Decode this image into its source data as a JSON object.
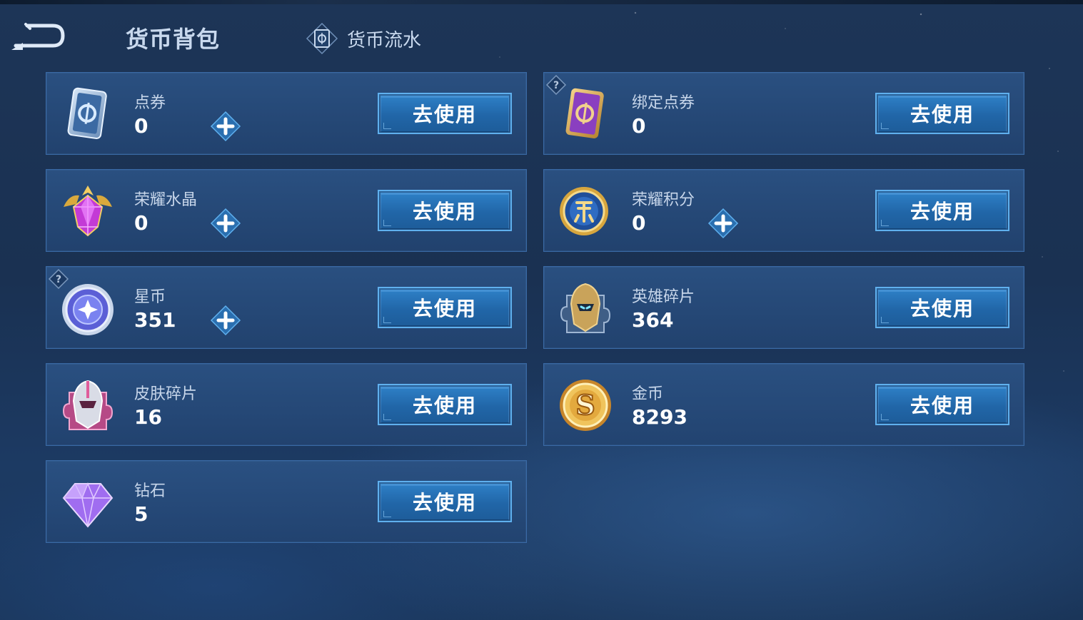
{
  "header": {
    "title": "货币背包",
    "flow_label": "货币流水"
  },
  "colors": {
    "accent": "#5fb0ee",
    "card_bg": "#2b5284",
    "button_bg": "#2166a8"
  },
  "currencies": [
    {
      "name": "点券",
      "value": "0",
      "icon": "voucher-card-icon",
      "has_add": true,
      "has_help": false,
      "button": "去使用"
    },
    {
      "name": "绑定点券",
      "value": "0",
      "icon": "bound-voucher-card-icon",
      "has_add": false,
      "has_help": true,
      "button": "去使用"
    },
    {
      "name": "荣耀水晶",
      "value": "0",
      "icon": "glory-crystal-icon",
      "has_add": true,
      "has_help": false,
      "button": "去使用"
    },
    {
      "name": "荣耀积分",
      "value": "0",
      "icon": "glory-points-icon",
      "has_add": true,
      "has_help": false,
      "button": "去使用"
    },
    {
      "name": "星币",
      "value": "351",
      "icon": "star-coin-icon",
      "has_add": true,
      "has_help": true,
      "button": "去使用"
    },
    {
      "name": "英雄碎片",
      "value": "364",
      "icon": "hero-fragment-icon",
      "has_add": false,
      "has_help": false,
      "button": "去使用"
    },
    {
      "name": "皮肤碎片",
      "value": "16",
      "icon": "skin-fragment-icon",
      "has_add": false,
      "has_help": false,
      "button": "去使用"
    },
    {
      "name": "金币",
      "value": "8293",
      "icon": "gold-coin-icon",
      "has_add": false,
      "has_help": false,
      "button": "去使用"
    },
    {
      "name": "钻石",
      "value": "5",
      "icon": "diamond-icon",
      "has_add": false,
      "has_help": false,
      "button": "去使用"
    }
  ]
}
